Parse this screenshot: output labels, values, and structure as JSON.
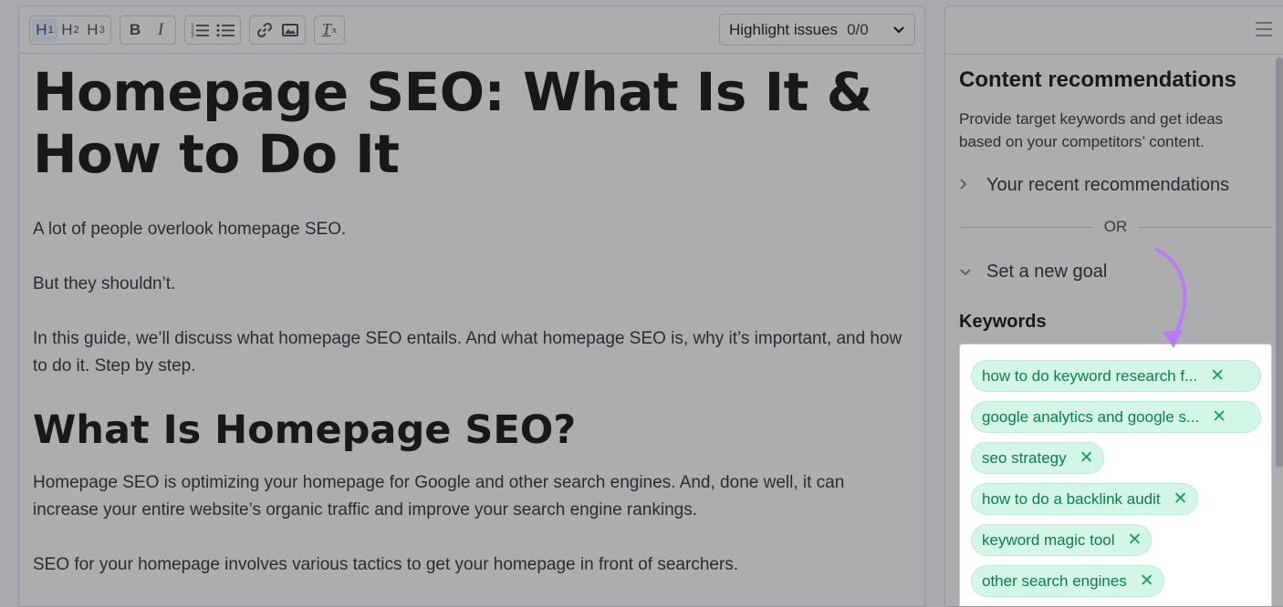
{
  "toolbar": {
    "headings": [
      "H1",
      "H2",
      "H3"
    ],
    "bold": "B",
    "italic": "I",
    "clear_format": "Tx",
    "highlight_label": "Highlight issues",
    "highlight_count": "0/0"
  },
  "document": {
    "title": "Homepage SEO: What Is It & How to Do It",
    "paragraphs_1": [
      "A lot of people overlook homepage SEO.",
      "But they shouldn’t.",
      "In this guide, we’ll discuss what homepage SEO entails. And what homepage SEO is, why it’s important, and how to do it. Step by step."
    ],
    "heading_2": "What Is Homepage SEO?",
    "paragraphs_2": [
      "Homepage SEO is optimizing your homepage for Google and other search engines. And, done well, it can increase your entire website’s organic traffic and improve your search engine rankings.",
      "SEO for your homepage involves various tactics to get your homepage in front of searchers."
    ]
  },
  "sidebar": {
    "title": "Content recommendations",
    "description": "Provide target keywords and get ideas based on your competitors’ content.",
    "recent_label": "Your recent recommendations",
    "or_label": "OR",
    "new_goal_label": "Set a new goal",
    "keywords_label": "Keywords",
    "keywords": [
      "how to do keyword research f...",
      "google analytics and google s...",
      "seo strategy",
      "how to do a backlink audit",
      "keyword magic tool",
      "other search engines"
    ]
  },
  "colors": {
    "chip_bg": "#d4f6e6",
    "chip_text": "#0d7a55",
    "annotation_arrow": "#b57cf5"
  }
}
